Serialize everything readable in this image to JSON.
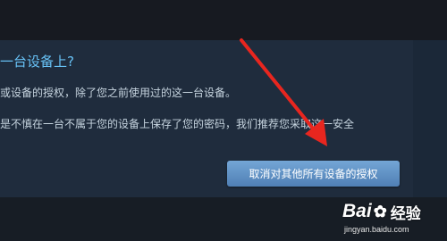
{
  "dialog": {
    "heading": "一台设备上?",
    "line1": "或设备的授权，除了您之前使用过的这一台设备。",
    "line2": "是不慎在一台不属于您的设备上保存了您的密码，我们推荐您采取这一安全",
    "deauthorize_button": "取消对其他所有设备的授权"
  },
  "annotation": {
    "arrow_color": "#e8261f"
  },
  "watermark": {
    "logo_left": "Bai",
    "logo_right": "经验",
    "url": "jingyan.baidu.com"
  },
  "colors": {
    "background": "#1b2838",
    "heading": "#67c1f5",
    "text": "#c6d4df",
    "button": "#5f90c4"
  }
}
